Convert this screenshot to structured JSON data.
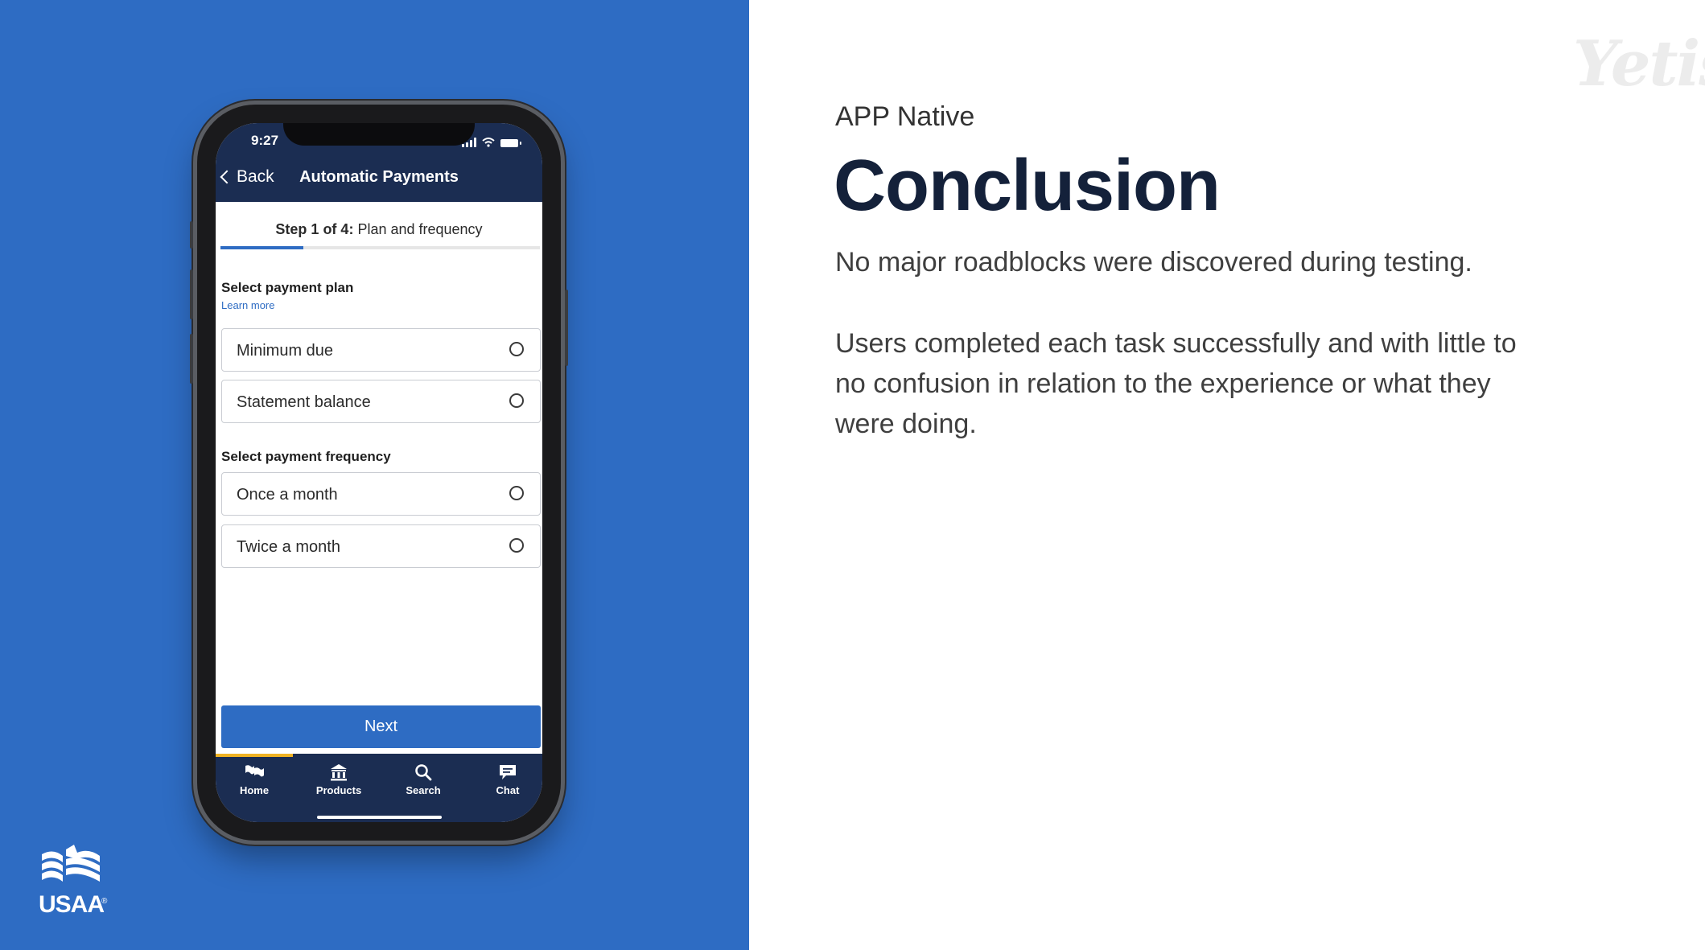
{
  "slide": {
    "subtitle": "APP Native",
    "headline": "Conclusion",
    "paragraph1": "No major roadblocks were discovered during testing.",
    "paragraph2": "Users completed each task successfully and with little to no confusion in relation to the experience or what they were doing.",
    "watermark": "Yetis",
    "brand_logo_text": "USAA",
    "brand_registered": "®"
  },
  "phone": {
    "status_time": "9:27",
    "nav": {
      "back_label": "Back",
      "title": "Automatic Payments"
    },
    "step": {
      "prefix": "Step 1 of 4:",
      "text": " Plan and frequency",
      "progress": 0.26
    },
    "payment_plan": {
      "label": "Select payment plan",
      "learn_more": "Learn more",
      "options": [
        "Minimum due",
        "Statement balance"
      ]
    },
    "payment_frequency": {
      "label": "Select payment frequency",
      "options": [
        "Once a month",
        "Twice a month"
      ]
    },
    "next_label": "Next",
    "tabs": [
      {
        "label": "Home",
        "icon": "home-flags-icon"
      },
      {
        "label": "Products",
        "icon": "bank-icon"
      },
      {
        "label": "Search",
        "icon": "search-icon"
      },
      {
        "label": "Chat",
        "icon": "chat-icon"
      }
    ]
  },
  "colors": {
    "left_panel": "#2e6cc3",
    "app_header": "#1b2d52",
    "accent": "#2e6cc3",
    "active_tab_indicator": "#f0b323",
    "headline": "#14213a"
  }
}
